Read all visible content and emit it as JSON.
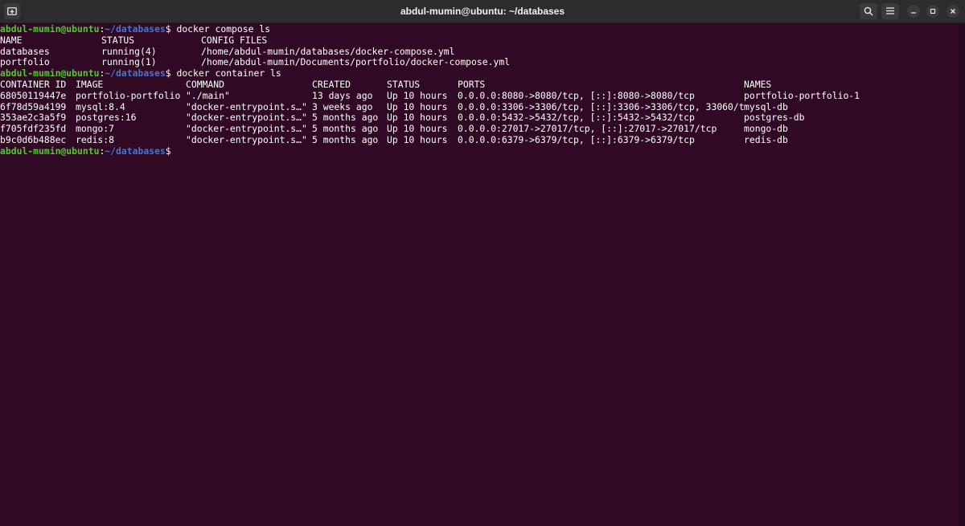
{
  "window": {
    "title": "abdul-mumin@ubuntu: ~/databases"
  },
  "icons": {
    "new_tab": "new-tab-icon",
    "search": "search-icon",
    "menu": "hamburger-menu-icon",
    "minimize": "minimize-icon",
    "maximize": "maximize-icon",
    "close": "close-icon"
  },
  "prompt": {
    "user_host": "abdul-mumin@ubuntu",
    "colon": ":",
    "path": "~/databases",
    "dollar": "$ "
  },
  "commands": {
    "compose_ls": "docker compose ls",
    "container_ls": "docker container ls"
  },
  "compose": {
    "headers": [
      "NAME",
      "STATUS",
      "CONFIG FILES"
    ],
    "rows": [
      [
        "databases",
        "running(4)",
        "/home/abdul-mumin/databases/docker-compose.yml"
      ],
      [
        "portfolio",
        "running(1)",
        "/home/abdul-mumin/Documents/portfolio/docker-compose.yml"
      ]
    ]
  },
  "containers": {
    "headers": [
      "CONTAINER ID",
      "IMAGE",
      "COMMAND",
      "CREATED",
      "STATUS",
      "PORTS",
      "NAMES"
    ],
    "rows": [
      [
        "68050119447e",
        "portfolio-portfolio",
        "\"./main\"",
        "13 days ago",
        "Up 10 hours",
        "0.0.0.0:8080->8080/tcp, [::]:8080->8080/tcp",
        "portfolio-portfolio-1"
      ],
      [
        "6f78d59a4199",
        "mysql:8.4",
        "\"docker-entrypoint.s…\"",
        "3 weeks ago",
        "Up 10 hours",
        "0.0.0.0:3306->3306/tcp, [::]:3306->3306/tcp, 33060/tcp",
        "mysql-db"
      ],
      [
        "353ae2c3a5f9",
        "postgres:16",
        "\"docker-entrypoint.s…\"",
        "5 months ago",
        "Up 10 hours",
        "0.0.0.0:5432->5432/tcp, [::]:5432->5432/tcp",
        "postgres-db"
      ],
      [
        "f705fdf235fd",
        "mongo:7",
        "\"docker-entrypoint.s…\"",
        "5 months ago",
        "Up 10 hours",
        "0.0.0.0:27017->27017/tcp, [::]:27017->27017/tcp",
        "mongo-db"
      ],
      [
        "b9c0d6b488ec",
        "redis:8",
        "\"docker-entrypoint.s…\"",
        "5 months ago",
        "Up 10 hours",
        "0.0.0.0:6379->6379/tcp, [::]:6379->6379/tcp",
        "redis-db"
      ]
    ]
  },
  "colors": {
    "background": "#300a24",
    "prompt_user": "#58c439",
    "prompt_path": "#4a74c9",
    "text": "#ffffff"
  }
}
